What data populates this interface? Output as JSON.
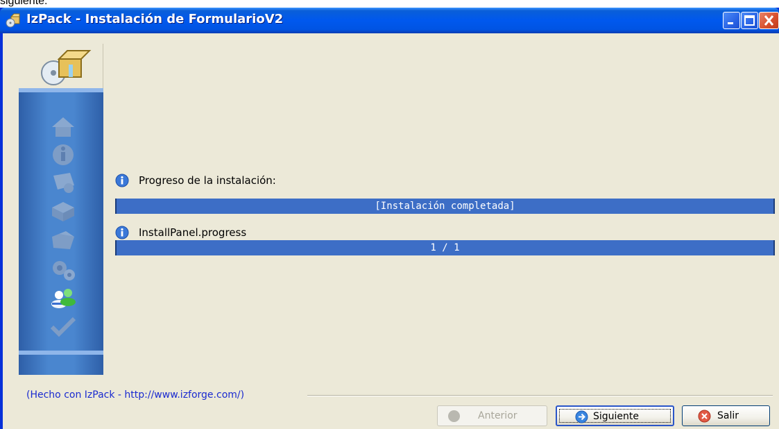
{
  "caption": {
    "text": "siguiente:"
  },
  "window": {
    "title": "IzPack - Instalación de FormularioV2",
    "title_icon": "installer-box-icon",
    "controls": [
      "minimize-icon",
      "maximize-icon",
      "close-icon"
    ]
  },
  "sidebar": {
    "icons": [
      "installer-box-icon",
      "home-icon",
      "info-icon",
      "license-icon",
      "packages-icon",
      "folder-icon",
      "gears-icon",
      "users-icon",
      "check-icon"
    ],
    "active": "users-icon"
  },
  "main": {
    "install_label": "Progreso de la instalación:",
    "install_status": "[Instalación completada]",
    "install_progress": 1.0,
    "pack_label": "InstallPanel.progress",
    "pack_status": "1 / 1",
    "pack_progress": 1.0
  },
  "footer": {
    "credit": "(Hecho con IzPack - http://www.izforge.com/)",
    "buttons": {
      "back": "Anterior",
      "next": "Siguiente",
      "quit": "Salir"
    }
  },
  "colors": {
    "titlebar": "#0054e3",
    "progress_fill": "#3d6ec6",
    "client_bg": "#ece9d8",
    "link": "#1a2ad0"
  }
}
